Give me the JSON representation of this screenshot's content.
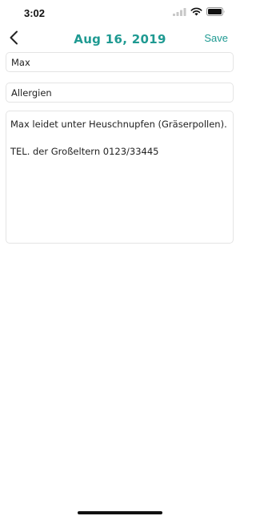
{
  "status_bar": {
    "time": "3:02",
    "icons": [
      "signal-icon",
      "wifi-icon",
      "battery-icon"
    ]
  },
  "nav": {
    "back_icon": "chevron-left-icon",
    "title": "Aug 16, 2019",
    "save_label": "Save",
    "accent_color": "#1f9a92"
  },
  "note": {
    "name": "Max",
    "title": "Allergien",
    "body_lines": [
      "Max leidet unter Heuschnupfen (Gräserpollen).",
      "TEL. der Großeltern 0123/33445"
    ]
  }
}
